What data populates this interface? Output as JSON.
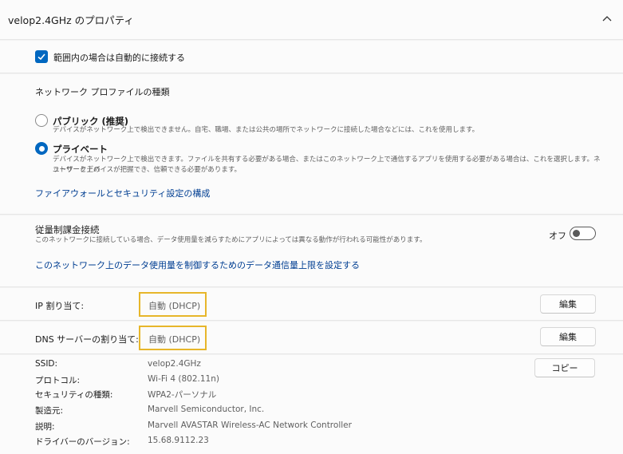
{
  "header": {
    "title": "velop2.4GHz のプロパティ"
  },
  "autoconnect": {
    "label": "範囲内の場合は自動的に接続する",
    "checked": true
  },
  "profile": {
    "heading": "ネットワーク プロファイルの種類",
    "public": {
      "title": "パブリック (推奨)",
      "desc": "デバイスがネットワーク上で検出できません。自宅、職場、または公共の場所でネットワークに接続した場合などには、これを使用します。",
      "selected": false
    },
    "private": {
      "title": "プライベート",
      "desc1": "デバイスがネットワーク上で検出できます。ファイルを共有する必要がある場合、またはこのネットワーク上で通信するアプリを使用する必要がある場合は、これを選択します。ネットワーク上の",
      "desc2": "ユーザーとデバイスが把握でき、信頼できる必要があります。",
      "selected": true
    },
    "firewall_link": "ファイアウォールとセキュリティ設定の構成"
  },
  "metered": {
    "title": "従量制課金接続",
    "desc": "このネットワークに接続している場合、データ使用量を減らすためにアプリによっては異なる動作が行われる可能性があります。",
    "toggle_label": "オフ",
    "toggle_on": false,
    "limit_link": "このネットワーク上のデータ使用量を制御するためのデータ通信量上限を設定する"
  },
  "ip": {
    "label": "IP 割り当て:",
    "value": "自動 (DHCP)",
    "edit": "編集"
  },
  "dns": {
    "label": "DNS サーバーの割り当て:",
    "value": "自動 (DHCP)",
    "edit": "編集"
  },
  "info": {
    "copy": "コピー",
    "rows": [
      {
        "label": "SSID:",
        "value": "velop2.4GHz"
      },
      {
        "label": "プロトコル:",
        "value": "Wi-Fi 4 (802.11n)"
      },
      {
        "label": "セキュリティの種類:",
        "value": "WPA2-パーソナル"
      },
      {
        "label": "製造元:",
        "value": "Marvell Semiconductor, Inc."
      },
      {
        "label": "説明:",
        "value": "Marvell AVASTAR Wireless-AC Network Controller"
      },
      {
        "label": "ドライバーのバージョン:",
        "value": "15.68.9112.23"
      }
    ]
  },
  "colors": {
    "accent": "#0067c0",
    "link": "#003e92",
    "highlight": "#e7b62a"
  }
}
